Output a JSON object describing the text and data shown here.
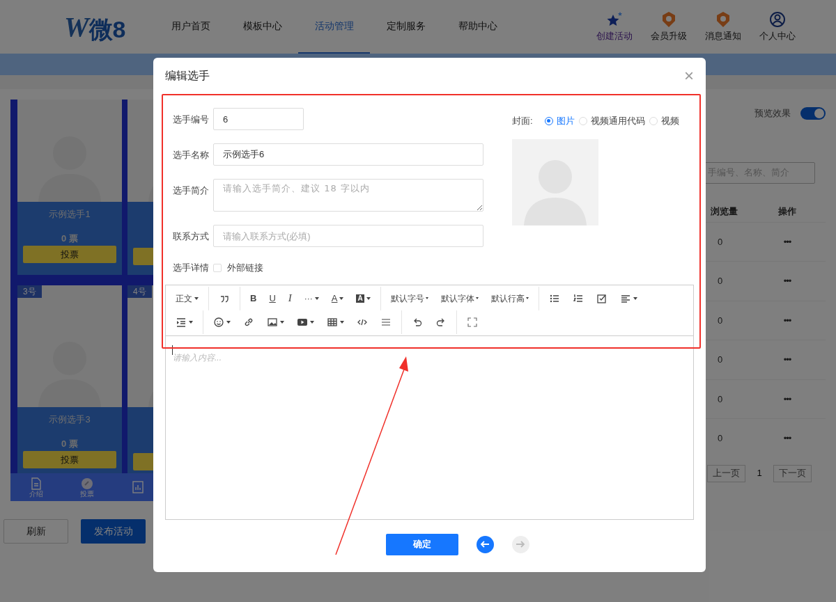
{
  "header": {
    "logo": {
      "mark": "W",
      "text": "微8"
    },
    "nav": [
      {
        "label": "用户首页",
        "selected": false
      },
      {
        "label": "模板中心",
        "selected": false
      },
      {
        "label": "活动管理",
        "selected": true
      },
      {
        "label": "定制服务",
        "selected": false
      },
      {
        "label": "帮助中心",
        "selected": false
      }
    ],
    "actions": [
      {
        "kind": "star",
        "label": "创建活动"
      },
      {
        "kind": "badge",
        "label": "会员升级"
      },
      {
        "kind": "badge",
        "label": "消息通知"
      },
      {
        "kind": "user",
        "label": "个人中心"
      }
    ]
  },
  "preview": {
    "cards": [
      {
        "kind": "full",
        "name": "示例选手1",
        "votes": "0 票",
        "vote_button": "投票"
      },
      {
        "kind": "covered"
      },
      {
        "kind": "full",
        "badge": "3号",
        "name": "示例选手3",
        "votes": "0 票",
        "vote_button": "投票"
      },
      {
        "kind": "covered",
        "badge": "4号"
      }
    ],
    "bottom_nav": [
      {
        "kind": "doc",
        "label": "介绍"
      },
      {
        "kind": "vote",
        "label": "投票"
      },
      {
        "kind": "chart"
      }
    ]
  },
  "buttons": [
    {
      "kind": "plain",
      "label": "刷新"
    },
    {
      "kind": "primary",
      "label": "发布活动"
    }
  ],
  "preview_toggle": {
    "label": "预览效果",
    "on": true
  },
  "search": {
    "placeholder": "手编号、名称、简介"
  },
  "table": {
    "columns": [
      "浏览量",
      "操作"
    ],
    "rows": [
      [
        "0",
        "•••"
      ],
      [
        "0",
        "•••"
      ],
      [
        "0",
        "•••"
      ],
      [
        "0",
        "•••"
      ],
      [
        "0",
        "•••"
      ],
      [
        "0",
        "•••"
      ]
    ]
  },
  "pagination": {
    "prev": "上一页",
    "page": "1",
    "next": "下一页"
  },
  "dialog": {
    "title": "编辑选手",
    "close": "×",
    "fields": [
      {
        "kind": "number",
        "label": "选手编号",
        "value": "6"
      },
      {
        "kind": "input",
        "label": "选手名称",
        "value": "示例选手6"
      },
      {
        "kind": "textarea",
        "label": "选手简介",
        "placeholder": "请输入选手简介、建议 18 字以内"
      },
      {
        "kind": "input",
        "label": "联系方式",
        "placeholder": "请输入联系方式(必填)"
      }
    ],
    "detail": {
      "label": "选手详情",
      "checkbox": {
        "label": "外部链接",
        "checked": false
      }
    },
    "cover": {
      "label": "封面:",
      "options": [
        {
          "label": "图片",
          "selected": true
        },
        {
          "label": "视频通用代码",
          "selected": false
        },
        {
          "label": "视频",
          "selected": false
        }
      ]
    },
    "toolbar_rows": [
      [
        [
          {
            "kind": "menu",
            "label": "正文"
          }
        ],
        [
          {
            "kind": "quote"
          }
        ],
        [
          {
            "kind": "bold",
            "label": "B"
          },
          {
            "kind": "underline",
            "label": "U"
          },
          {
            "kind": "italic",
            "label": "I"
          },
          {
            "kind": "menu",
            "label": "···"
          },
          {
            "kind": "fontcolor",
            "label": "A"
          },
          {
            "kind": "backcolor",
            "label": "A"
          }
        ],
        [
          {
            "kind": "smallmenu",
            "label": "默认字号"
          },
          {
            "kind": "smallmenu",
            "label": "默认字体"
          },
          {
            "kind": "smallmenu",
            "label": "默认行高"
          }
        ],
        [
          {
            "kind": "bullets"
          },
          {
            "kind": "numbers"
          },
          {
            "kind": "todo"
          },
          {
            "kind": "align"
          }
        ]
      ],
      [
        [
          {
            "kind": "indent"
          }
        ],
        [
          {
            "kind": "emoji"
          },
          {
            "kind": "link"
          },
          {
            "kind": "image"
          },
          {
            "kind": "video"
          },
          {
            "kind": "table"
          },
          {
            "kind": "code"
          },
          {
            "kind": "divider"
          }
        ],
        [
          {
            "kind": "undo"
          },
          {
            "kind": "redo"
          }
        ],
        [
          {
            "kind": "fullscreen"
          }
        ]
      ]
    ],
    "editor": {
      "placeholder": "请输入内容..."
    },
    "confirm": "确定",
    "back": {
      "disabled": false
    },
    "forward": {
      "disabled": true
    }
  }
}
